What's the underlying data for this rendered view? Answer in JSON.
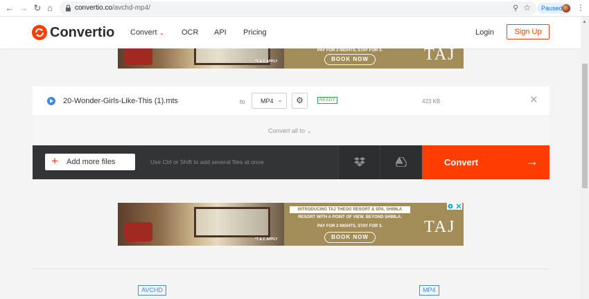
{
  "browser": {
    "url_host": "convertio.co",
    "url_path": "/avchd-mp4/",
    "profile_status": "Paused",
    "icons": [
      "back-icon",
      "forward-icon",
      "reload-icon",
      "home-icon",
      "lock-icon",
      "zoom-icon",
      "star-icon",
      "menu-icon"
    ]
  },
  "header": {
    "logo": "Convertio",
    "menu": {
      "convert": "Convert",
      "ocr": "OCR",
      "api": "API",
      "pricing": "Pricing"
    },
    "login": "Login",
    "signup": "Sign Up"
  },
  "ad": {
    "title": "INTRODUCING TAJ THEOG RESORT & SPA, SHIMLA",
    "line1": "RESORT WITH A POINT OF VIEW. BEYOND SHIMLA.",
    "line2": "PAY FOR 2 NIGHTS, STAY FOR 3.",
    "cta": "BOOK NOW",
    "terms": "*T & C APPLY",
    "brand": "TAJ"
  },
  "converter": {
    "file_name": "20-Wonder-Girls-Like-This (1).mts",
    "to_label": "to",
    "format": "MP4",
    "status": "READY",
    "size": "423 KB",
    "convert_all": "Convert all to",
    "add_more": "Add more files",
    "hint": "Use Ctrl or Shift to add several files at once",
    "convert": "Convert"
  },
  "formats": {
    "source": "AVCHD",
    "target": "MP4"
  },
  "colors": {
    "accent": "#ff3d00",
    "dark_bar": "#333436",
    "ready": "#36a44f",
    "link_blue": "#3c8be8"
  }
}
